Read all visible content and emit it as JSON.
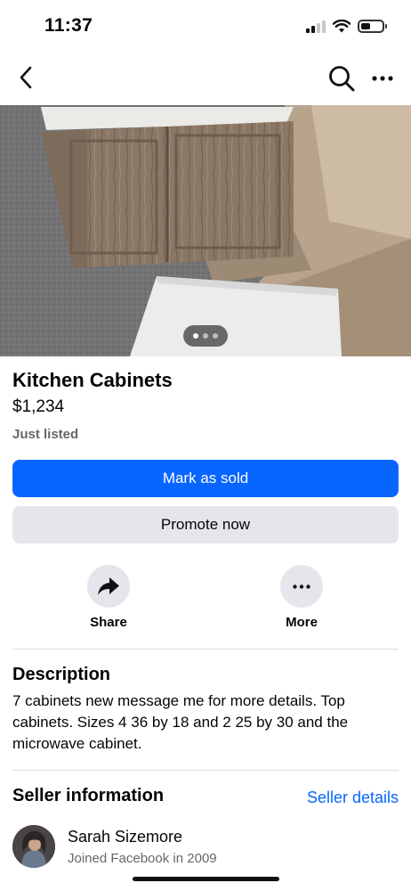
{
  "status_bar": {
    "time": "11:37",
    "icons": [
      "cellular-signal-icon",
      "wifi-icon",
      "battery-icon"
    ]
  },
  "nav": {
    "icons": [
      "back-icon",
      "search-icon",
      "more-icon"
    ]
  },
  "photo": {
    "subject": "kitchen cabinets photo",
    "page_indicator_count": 3,
    "page_indicator_active": 1
  },
  "listing": {
    "title": "Kitchen Cabinets",
    "price": "$1,234",
    "status": "Just listed"
  },
  "buttons": {
    "mark_sold": "Mark as sold",
    "promote": "Promote now"
  },
  "actions": {
    "share": "Share",
    "more": "More"
  },
  "description": {
    "heading": "Description",
    "body": "7 cabinets new message me for more details. Top cabinets. Sizes 4 36 by 18 and 2 25 by 30 and the microwave cabinet."
  },
  "seller": {
    "heading": "Seller information",
    "details_link": "Seller details",
    "name": "Sarah Sizemore",
    "joined": "Joined Facebook in 2009"
  },
  "colors": {
    "accent": "#0866ff",
    "secondary_button": "#e4e6eb",
    "muted_text": "#65676b",
    "divider": "#dadde1"
  }
}
